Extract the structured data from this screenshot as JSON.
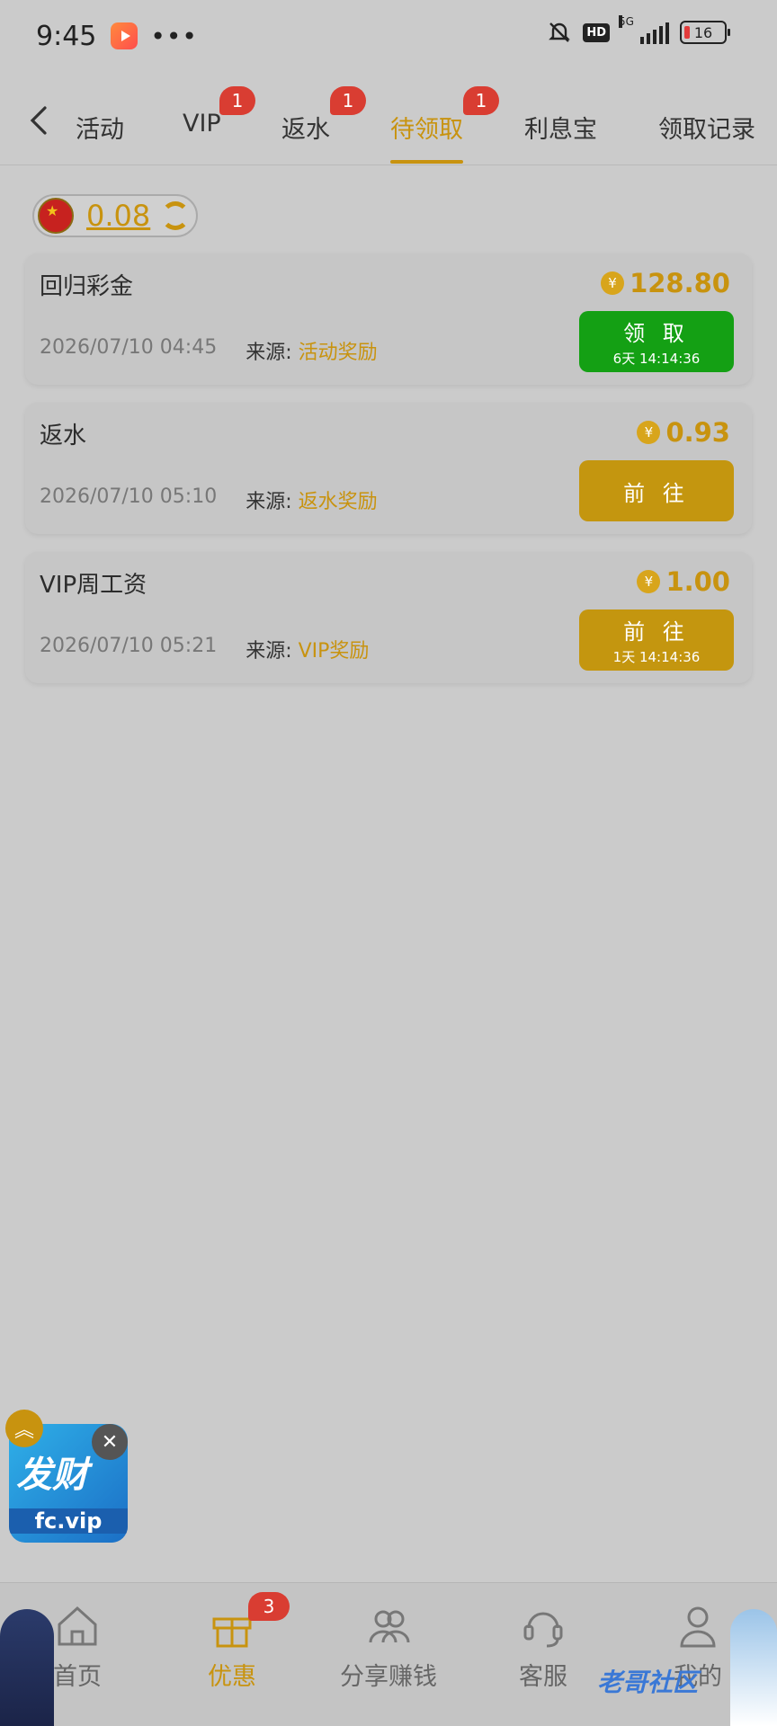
{
  "status_bar": {
    "time": "9:45",
    "dots": "•••",
    "hd": "HD",
    "network": "5G",
    "battery": "16"
  },
  "tabs": [
    {
      "label": "活动",
      "badge": ""
    },
    {
      "label": "VIP",
      "badge": "1"
    },
    {
      "label": "返水",
      "badge": "1"
    },
    {
      "label": "待领取",
      "badge": "1",
      "active": true
    },
    {
      "label": "利息宝",
      "badge": ""
    },
    {
      "label": "领取记录",
      "badge": ""
    }
  ],
  "balance": {
    "value": "0.08"
  },
  "rewards": [
    {
      "title": "回归彩金",
      "amount": "128.80",
      "datetime": "2026/07/10 04:45",
      "source_label": "来源:",
      "source": "活动奖励",
      "button_label": "领 取",
      "button_sub": "6天 14:14:36",
      "button_color": "#14a014"
    },
    {
      "title": "返水",
      "amount": "0.93",
      "datetime": "2026/07/10 05:10",
      "source_label": "来源:",
      "source": "返水奖励",
      "button_label": "前 往",
      "button_sub": "",
      "button_color": "#c4960f"
    },
    {
      "title": "VIP周工资",
      "amount": "1.00",
      "datetime": "2026/07/10 05:21",
      "source_label": "来源:",
      "source": "VIP奖励",
      "button_label": "前 往",
      "button_sub": "1天 14:14:36",
      "button_color": "#c4960f"
    }
  ],
  "coin_symbol": "¥",
  "float_ad": {
    "text": "发财",
    "url": "fc.vip"
  },
  "bottom_nav": [
    {
      "label": "首页",
      "icon": "home-icon"
    },
    {
      "label": "优惠",
      "icon": "gift-icon",
      "badge": "3",
      "active": true
    },
    {
      "label": "分享赚钱",
      "icon": "share-users-icon"
    },
    {
      "label": "客服",
      "icon": "headset-icon"
    },
    {
      "label": "我的",
      "icon": "user-icon"
    }
  ],
  "watermark": "老哥社区",
  "colors": {
    "accent": "#c8930f",
    "badge": "#d93d32",
    "claim_green": "#14a014"
  }
}
